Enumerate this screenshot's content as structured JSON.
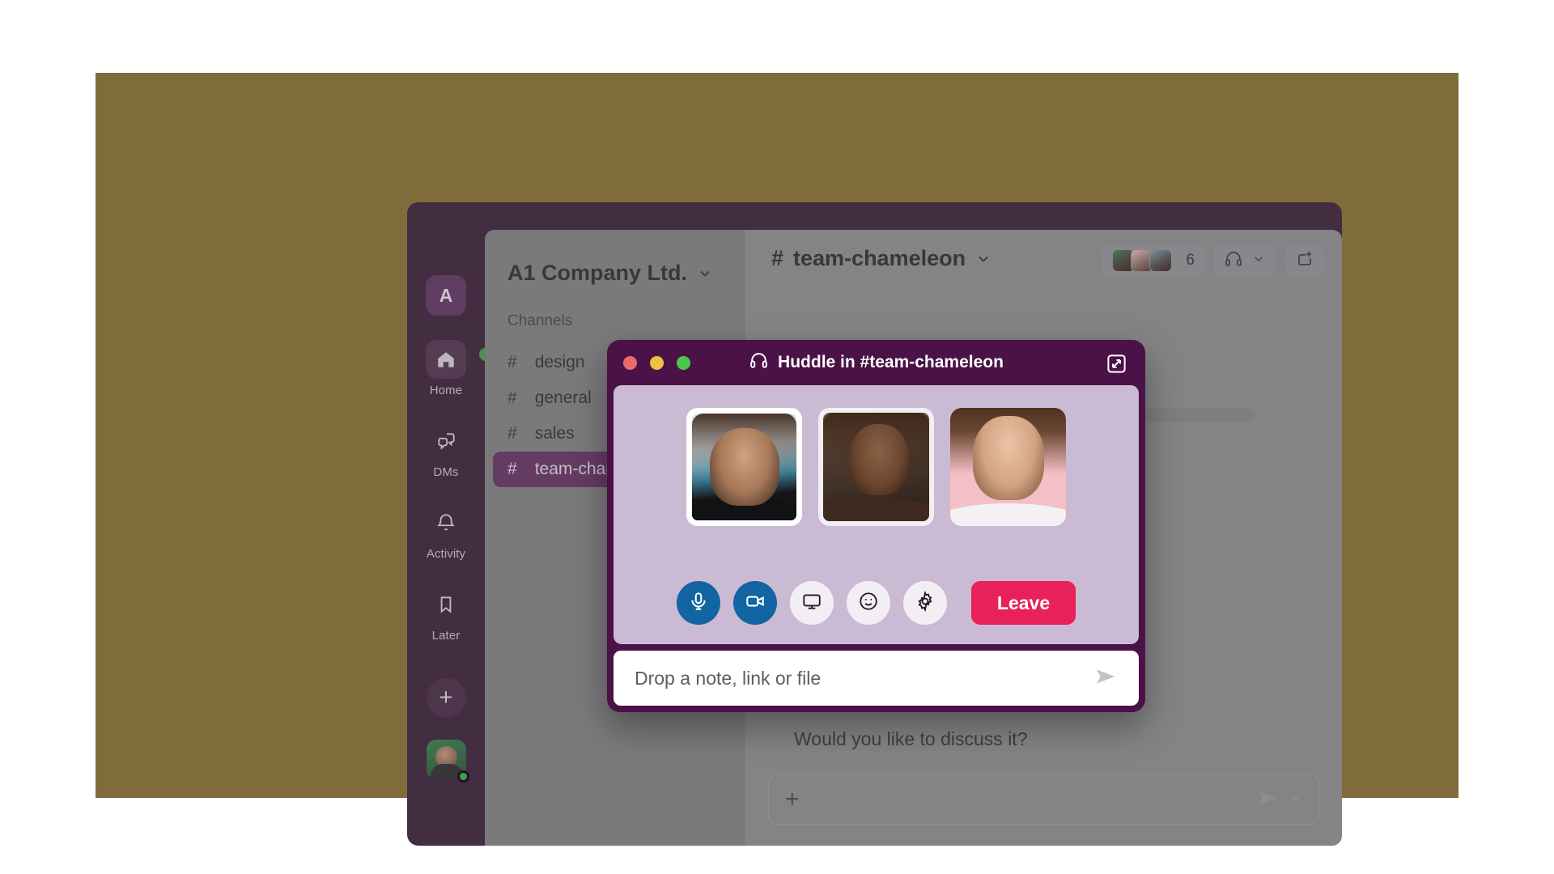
{
  "canvas": {
    "page_background": "#ffffff",
    "stage_background": "#806c3a"
  },
  "app_window": {
    "background": "#2b0f28",
    "traffic_lights": [
      {
        "name": "close",
        "color": "#9c4b4b"
      },
      {
        "name": "minimize",
        "color": "#b59a3a"
      },
      {
        "name": "maximize",
        "color": "#3a9a3e"
      }
    ]
  },
  "rail": {
    "workspace_badge": "A",
    "items": [
      {
        "label": "Home",
        "icon": "home-icon",
        "active": true
      },
      {
        "label": "DMs",
        "icon": "chat-bubbles-icon",
        "active": false
      },
      {
        "label": "Activity",
        "icon": "bell-icon",
        "active": false
      },
      {
        "label": "Later",
        "icon": "bookmark-icon",
        "active": false
      }
    ],
    "new_button": "+",
    "avatar": {
      "icon": "user-avatar",
      "presence": "online",
      "presence_color": "#2fa84b"
    }
  },
  "sidebar": {
    "workspace_name": "A1 Company Ltd.",
    "workspace_chevron": "chevron-down-icon",
    "section_label": "Channels",
    "channels": [
      {
        "hash": "#",
        "name": "design",
        "active": false
      },
      {
        "hash": "#",
        "name": "general",
        "active": false
      },
      {
        "hash": "#",
        "name": "sales",
        "active": false
      },
      {
        "hash": "#",
        "name": "team-chameleon",
        "active": true
      }
    ],
    "active_color": "#5c2159"
  },
  "main": {
    "channel_hash": "#",
    "channel_name": "team-chameleon",
    "channel_chevron": "chevron-down-icon",
    "member_count": "6",
    "huddle_icon": "headphones-icon",
    "huddle_chevron": "chevron-down-icon",
    "canvas_icon": "add-note-icon",
    "body_text": "Would you like to discuss it?",
    "composer": {
      "plus": "+",
      "send_icon": "send-icon",
      "chevron": "chevron-down-icon"
    }
  },
  "huddle": {
    "title": "Huddle in #team-chameleon",
    "title_icon": "headphones-icon",
    "expand_icon": "expand-icon",
    "frame_color": "#4a1246",
    "stage_color": "#cbbad3",
    "traffic_lights": [
      {
        "name": "close",
        "color": "#ec6a6f"
      },
      {
        "name": "minimize",
        "color": "#f0c03f"
      },
      {
        "name": "maximize",
        "color": "#4cc64c"
      }
    ],
    "participants": [
      {
        "name": "participant-1",
        "tile": "t1"
      },
      {
        "name": "participant-2",
        "tile": "t2"
      },
      {
        "name": "participant-3",
        "tile": "t3"
      }
    ],
    "controls": [
      {
        "name": "microphone",
        "icon": "microphone-icon",
        "state": "on",
        "color": "#1264a3"
      },
      {
        "name": "video",
        "icon": "video-camera-icon",
        "state": "on",
        "color": "#1264a3"
      },
      {
        "name": "screen-share",
        "icon": "screen-icon",
        "state": "off",
        "color": "#f2eef4"
      },
      {
        "name": "reaction",
        "icon": "smiley-icon",
        "state": "off",
        "color": "#f2eef4"
      },
      {
        "name": "settings",
        "icon": "gear-icon",
        "state": "off",
        "color": "#f2eef4"
      }
    ],
    "leave_label": "Leave",
    "leave_color": "#e8215a",
    "note_placeholder": "Drop a note, link or file",
    "note_send_icon": "send-icon"
  }
}
